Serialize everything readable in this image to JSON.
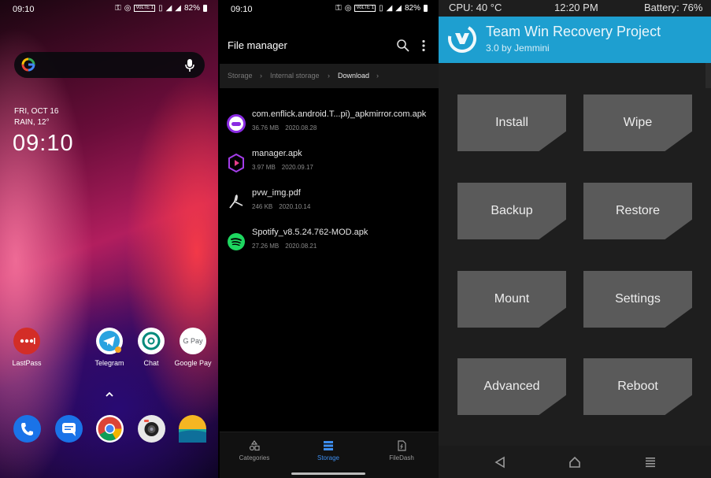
{
  "home": {
    "status": {
      "time": "09:10",
      "volte": "VoLTE 1",
      "battery": "82%"
    },
    "weather": {
      "date": "FRI, OCT 16",
      "condition": "RAIN, 12°"
    },
    "clock": "09:10",
    "apps": [
      {
        "label": "LastPass",
        "color": "#d32d27"
      },
      {
        "label": "Telegram",
        "color": "#ffffff"
      },
      {
        "label": "Chat",
        "color": "#ffffff"
      },
      {
        "label": "Google Pay",
        "color": "#ffffff"
      }
    ],
    "gpay_icon_text": "G Pay",
    "dock": [
      "phone-icon",
      "messages-icon",
      "chrome-icon",
      "camera-icon",
      "weather-icon"
    ]
  },
  "files": {
    "status": {
      "time": "09:10",
      "volte": "VoLTE 1",
      "battery": "82%"
    },
    "title": "File manager",
    "breadcrumb": [
      "Storage",
      "Internal storage",
      "Download"
    ],
    "items": [
      {
        "name": "com.enflick.android.T...pi)_apkmirror.com.apk",
        "size": "36.76 MB",
        "date": "2020.08.28",
        "icon": "textnow-icon"
      },
      {
        "name": "manager.apk",
        "size": "3.97 MB",
        "date": "2020.09.17",
        "icon": "manager-app-icon"
      },
      {
        "name": "pvw_img.pdf",
        "size": "246 KB",
        "date": "2020.10.14",
        "icon": "pdf-icon"
      },
      {
        "name": "Spotify_v8.5.24.762-MOD.apk",
        "size": "27.26 MB",
        "date": "2020.08.21",
        "icon": "spotify-icon"
      }
    ],
    "tabs": [
      {
        "label": "Categories",
        "active": false
      },
      {
        "label": "Storage",
        "active": true
      },
      {
        "label": "FileDash",
        "active": false
      }
    ],
    "accent": "#3d8ef0"
  },
  "twrp": {
    "status": {
      "cpu": "CPU: 40 °C",
      "time": "12:20 PM",
      "battery": "Battery: 76%"
    },
    "title": "Team Win Recovery Project",
    "subtitle": "3.0 by Jemmini",
    "buttons": [
      "Install",
      "Wipe",
      "Backup",
      "Restore",
      "Mount",
      "Settings",
      "Advanced",
      "Reboot"
    ],
    "header_color": "#1e9fd0",
    "button_color": "#5a5a5a"
  }
}
